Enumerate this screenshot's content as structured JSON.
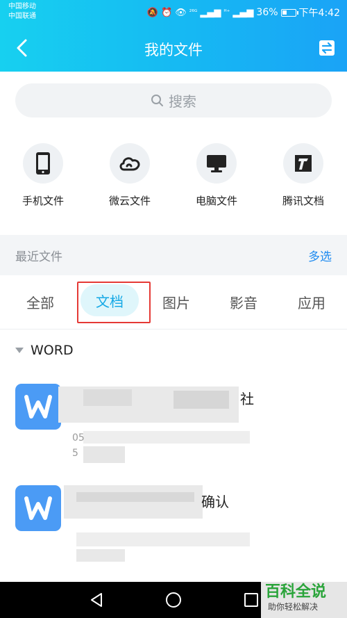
{
  "status": {
    "carrier1": "中国移动",
    "carrier2": "中国联通",
    "signal_text": "²⁶ᴳ",
    "signal_text2": "ᴴ⁺",
    "battery": "36%",
    "battery_fraction": 0.36,
    "time": "下午4:42"
  },
  "header": {
    "title": "我的文件"
  },
  "search": {
    "placeholder": "搜索"
  },
  "quick": [
    {
      "label": "手机文件",
      "icon": "phone-icon"
    },
    {
      "label": "微云文件",
      "icon": "cloud-icon"
    },
    {
      "label": "电脑文件",
      "icon": "monitor-icon"
    },
    {
      "label": "腾讯文档",
      "icon": "tencent-docs-icon"
    }
  ],
  "recent": {
    "label": "最近文件",
    "multi": "多选"
  },
  "tabs": [
    "全部",
    "文档",
    "图片",
    "影音",
    "应用"
  ],
  "active_tab": "文档",
  "section": {
    "title": "WORD"
  },
  "files": [
    {
      "name_visible": "社",
      "meta1": "05",
      "meta2": "5"
    },
    {
      "name_visible": "确认",
      "meta1": "",
      "meta2": ""
    }
  ],
  "watermark": {
    "title": "百科全说",
    "subtitle": "助你轻松解决"
  },
  "colors": {
    "accent": "#16b8f3",
    "link": "#1f8bf0",
    "word": "#4b9bf5",
    "highlight": "#e53935"
  }
}
